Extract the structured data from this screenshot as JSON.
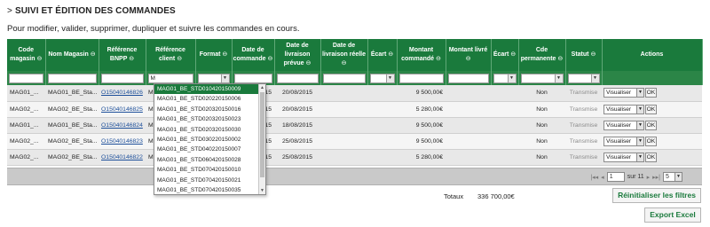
{
  "section": {
    "arrow": ">",
    "title": "SUIVI ET ÉDITION DES COMMANDES"
  },
  "intro": "Pour modifier, valider, supprimer, dupliquer et suivre les commandes en cours.",
  "sort_glyph": "⊖",
  "columns": [
    "Code magasin",
    "Nom Magasin",
    "Référence BNPP",
    "Référence client",
    "Format",
    "Date de commande",
    "Date de livraison prévue",
    "Date de livraison réelle",
    "Écart",
    "Montant commandé",
    "Montant livré",
    "Écart",
    "Cde permanente",
    "Statut",
    "Actions"
  ],
  "filters": {
    "reference_client_value": "M"
  },
  "rows": [
    {
      "code": "MAG01_...",
      "nom": "MAG01_BE_Sta...",
      "ref_bnpp": "O15040146826",
      "ref_client": "M",
      "date_cmd": "4/2015",
      "date_prevue": "20/08/2015",
      "montant": "9 500,00€",
      "permanente": "Non",
      "statut": "Transmise",
      "action": "Visualiser",
      "ok": "OK"
    },
    {
      "code": "MAG02_...",
      "nom": "MAG02_BE_Sta...",
      "ref_bnpp": "O15040146825",
      "ref_client": "M",
      "date_cmd": "4/2015",
      "date_prevue": "20/08/2015",
      "montant": "5 280,00€",
      "permanente": "Non",
      "statut": "Transmise",
      "action": "Visualiser",
      "ok": "OK"
    },
    {
      "code": "MAG01_...",
      "nom": "MAG01_BE_Sta...",
      "ref_bnpp": "O15040146824",
      "ref_client": "M",
      "date_cmd": "4/2015",
      "date_prevue": "18/08/2015",
      "montant": "9 500,00€",
      "permanente": "Non",
      "statut": "Transmise",
      "action": "Visualiser",
      "ok": "OK"
    },
    {
      "code": "MAG02_...",
      "nom": "MAG02_BE_Sta...",
      "ref_bnpp": "O15040146823",
      "ref_client": "M",
      "date_cmd": "4/2015",
      "date_prevue": "25/08/2015",
      "montant": "9 500,00€",
      "permanente": "Non",
      "statut": "Transmise",
      "action": "Visualiser",
      "ok": "OK"
    },
    {
      "code": "MAG02_...",
      "nom": "MAG02_BE_Sta...",
      "ref_bnpp": "O15040146822",
      "ref_client": "M",
      "date_cmd": "4/2015",
      "date_prevue": "25/08/2015",
      "montant": "5 280,00€",
      "permanente": "Non",
      "statut": "Transmise",
      "action": "Visualiser",
      "ok": "OK"
    }
  ],
  "autocomplete": {
    "items": [
      "MAG01_BE_STD010420150009",
      "MAG01_BE_STD020220150006",
      "MAG01_BE_STD020320150016",
      "MAG01_BE_STD020320150023",
      "MAG01_BE_STD020320150030",
      "MAG01_BE_STD030220150002",
      "MAG01_BE_STD040220150007",
      "MAG01_BE_STD060420150028",
      "MAG01_BE_STD070420150010",
      "MAG01_BE_STD070420150021",
      "MAG01_BE_STD070420150035"
    ],
    "selected_index": 0
  },
  "pager": {
    "first": "|◂◂",
    "prev": "◂",
    "page": "1",
    "of_label": "sur 11",
    "next": "▸",
    "last": "▸▸|",
    "page_size": "5"
  },
  "totals": {
    "label": "Totaux",
    "value": "336 700,00€"
  },
  "buttons": {
    "reset": "Réinitialiser les filtres",
    "export": "Export Excel"
  }
}
